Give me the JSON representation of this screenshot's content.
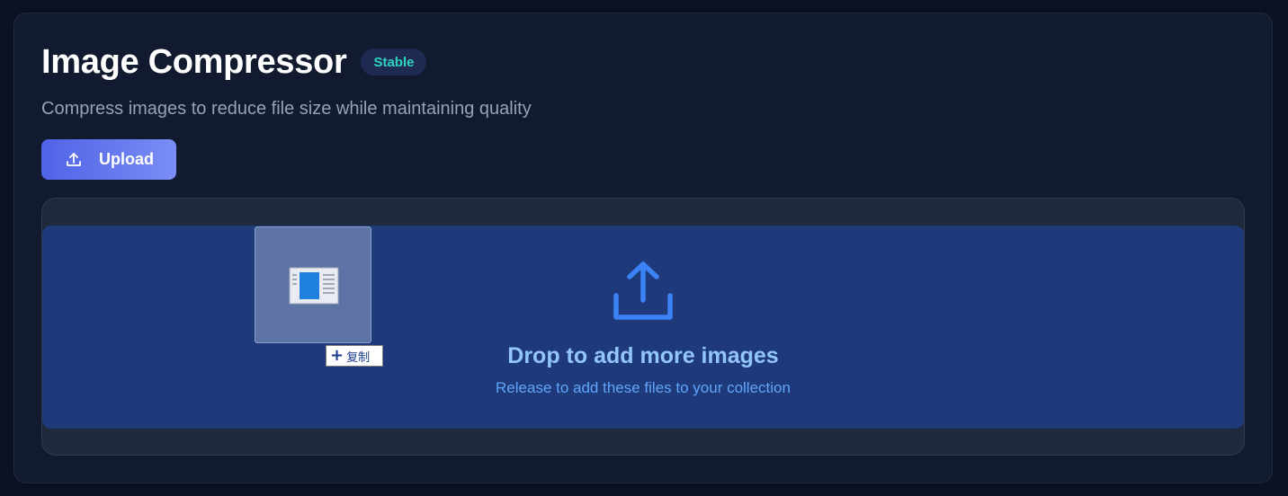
{
  "header": {
    "title": "Image Compressor",
    "badge": "Stable",
    "subtitle": "Compress images to reduce file size while maintaining quality"
  },
  "toolbar": {
    "upload_label": "Upload",
    "upload_icon": "upload-icon"
  },
  "dropzone": {
    "icon": "upload-icon",
    "title": "Drop to add more images",
    "subtitle": "Release to add these files to your collection"
  },
  "drag_ghost": {
    "icon": "file-thumbnail-icon",
    "tooltip_plus": "+",
    "tooltip_label": "复制"
  },
  "colors": {
    "background": "#0b1120",
    "card": "#111a2e",
    "accent": "#4f63e6",
    "badge_text": "#2dd4bf",
    "drop_overlay": "#1e3a7a",
    "drop_icon": "#3b82f6"
  }
}
